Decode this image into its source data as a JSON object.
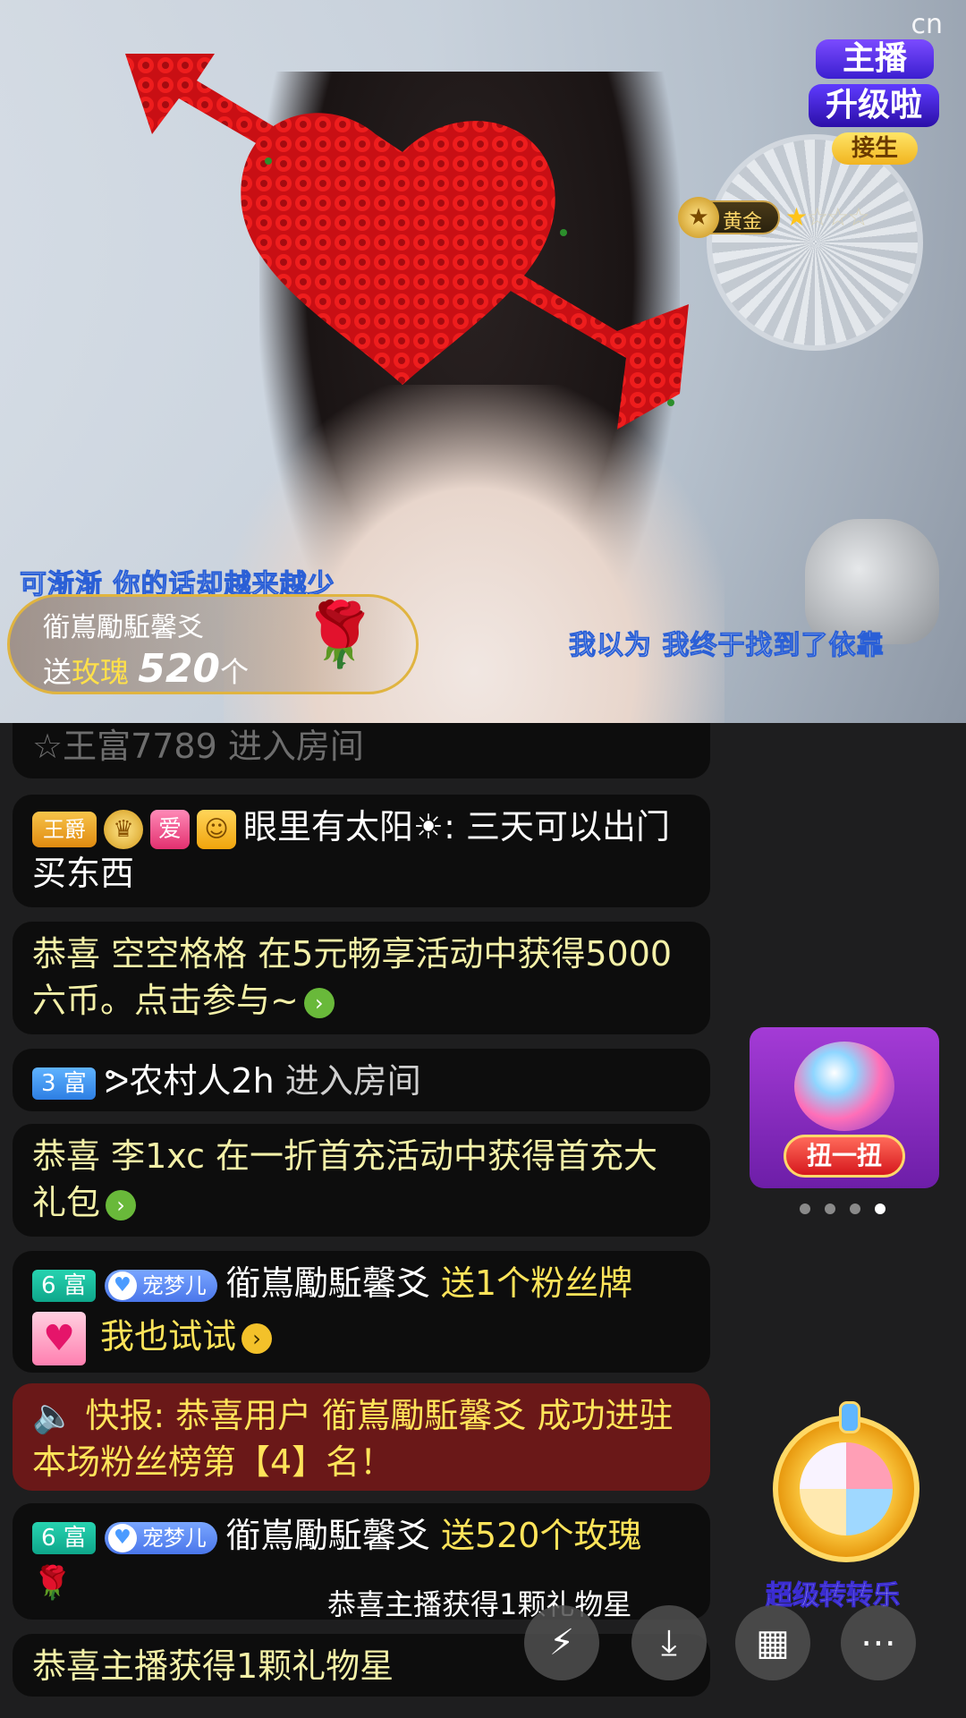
{
  "stream": {
    "watermark": "cn",
    "lyric_top": "可渐渐  你的话却越来越少",
    "lyric_bottom": "我以为  我终于找到了依靠",
    "level_badge": "黄金",
    "promo": {
      "line1": "主播",
      "line2": "升级啦",
      "line3": "接生"
    },
    "gift_banner": {
      "sender": "衜嶌勵駈馨爻",
      "send_word": "送",
      "gift_name": "玫瑰",
      "count": "520",
      "unit": "个"
    }
  },
  "chat": {
    "partial": "☆王富7789 进入房间",
    "m1": {
      "title": "王爵",
      "love": "爱",
      "name": "眼里有太阳☀",
      "text": ": 三天可以出门买东西"
    },
    "m2": {
      "text": "恭喜 空空格格 在5元畅享活动中获得5000六币。点击参与~"
    },
    "m3": {
      "rank": "3 富",
      "name": "ᕗ农村人2h",
      "text": " 进入房间"
    },
    "m4": {
      "text": "恭喜 李1xc 在一折首充活动中获得首充大礼包"
    },
    "m5": {
      "rank": "6 富",
      "fan": "宠梦儿",
      "name": "衜嶌勵駈馨爻",
      "gift": " 送1个粉丝牌",
      "cta": "我也试试"
    },
    "m6": {
      "text": "快报: 恭喜用户 衜嶌勵駈馨爻 成功进驻本场粉丝榜第【4】名！"
    },
    "m7": {
      "rank": "6 富",
      "fan": "宠梦儿",
      "name": "衜嶌勵駈馨爻",
      "gift": " 送520个玫瑰"
    },
    "m8": {
      "text": "恭喜主播获得1颗礼物星"
    }
  },
  "side": {
    "ad_button": "扭一扭",
    "wheel_label": "超级转转乐"
  },
  "toast": "恭喜主播获得1颗礼物星",
  "icons": [
    "share-icon",
    "download-icon",
    "grid-icon",
    "more-icon",
    "rose-icon",
    "speaker-icon"
  ],
  "colors": {
    "highlight": "#ffe45a",
    "background": "#1e1e1f",
    "alert": "#7a1818"
  }
}
